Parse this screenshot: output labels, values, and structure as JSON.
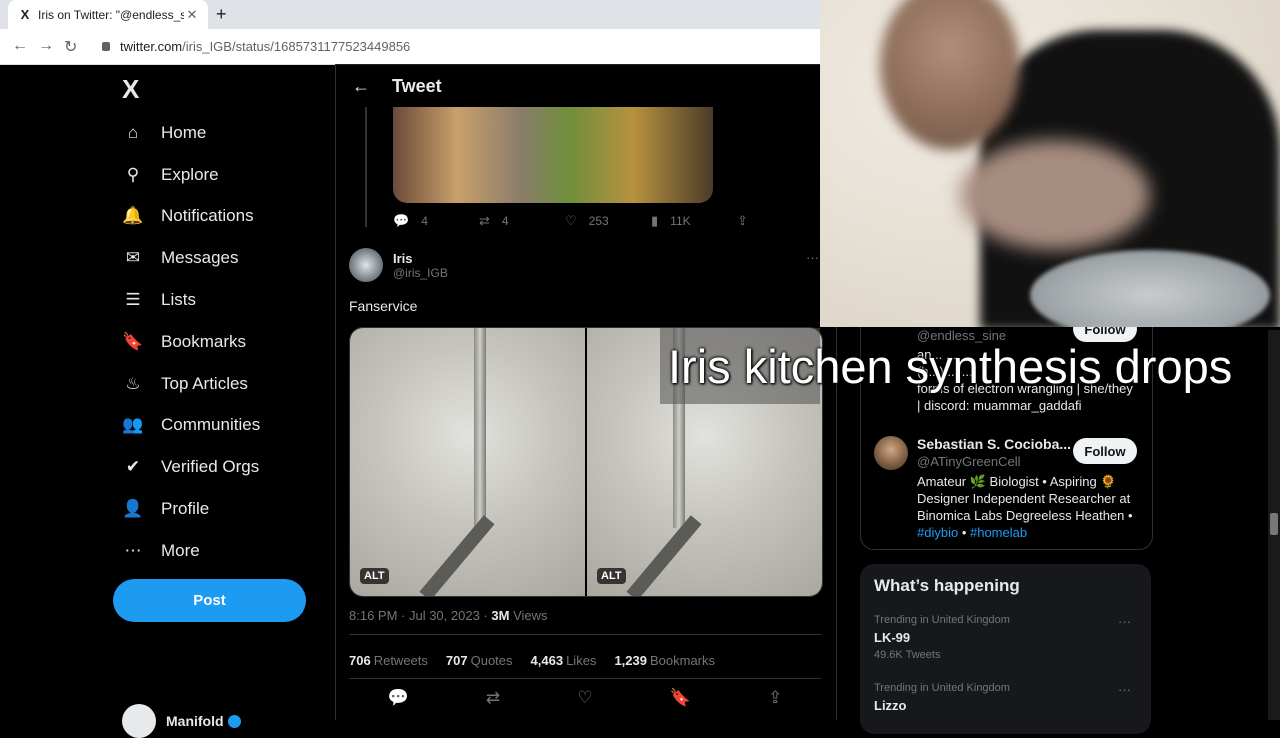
{
  "browser": {
    "tab_title": "Iris on Twitter: \"@endless_sine @",
    "tab_favicon": "X",
    "url_host": "twitter.com",
    "url_path": "/iris_IGB/status/1685731177523449856"
  },
  "sidebar": {
    "logo": "X",
    "items": [
      {
        "label": "Home",
        "icon": "home-icon",
        "glyph": "⌂"
      },
      {
        "label": "Explore",
        "icon": "search-icon",
        "glyph": "⚲"
      },
      {
        "label": "Notifications",
        "icon": "bell-icon",
        "glyph": "🔔"
      },
      {
        "label": "Messages",
        "icon": "envelope-icon",
        "glyph": "✉"
      },
      {
        "label": "Lists",
        "icon": "list-icon",
        "glyph": "☰"
      },
      {
        "label": "Bookmarks",
        "icon": "bookmark-icon",
        "glyph": "🔖"
      },
      {
        "label": "Top Articles",
        "icon": "flame-icon",
        "glyph": "♨"
      },
      {
        "label": "Communities",
        "icon": "people-icon",
        "glyph": "👥"
      },
      {
        "label": "Verified Orgs",
        "icon": "verified-icon",
        "glyph": "✔"
      },
      {
        "label": "Profile",
        "icon": "person-icon",
        "glyph": "👤"
      },
      {
        "label": "More",
        "icon": "more-circle-icon",
        "glyph": "⋯"
      }
    ],
    "post_label": "Post",
    "account_name": "Manifold"
  },
  "tweet": {
    "header_title": "Tweet",
    "prev_stats": {
      "replies": "4",
      "retweets": "4",
      "likes": "253",
      "views": "11K"
    },
    "author_name": "Iris",
    "author_handle": "@iris_IGB",
    "text": "Fanservice",
    "alt_label": "ALT",
    "time": "8:16 PM · Jul 30, 2023 ·",
    "views_count": "3M",
    "views_label": "Views",
    "counts": [
      {
        "value": "706",
        "label": "Retweets"
      },
      {
        "value": "707",
        "label": "Quotes"
      },
      {
        "value": "4,463",
        "label": "Likes"
      },
      {
        "value": "1,239",
        "label": "Bookmarks"
      }
    ]
  },
  "right": {
    "user1": {
      "handle": "@endless_sine",
      "follow": "Follow",
      "bio_lines": [
        "an... ...",
        "(h...) ... ...",
        "forms of electron wrangling | she/they",
        "| discord: muammar_gaddafi"
      ]
    },
    "user2": {
      "name": "Sebastian S. Cocioba...",
      "handle": "@ATinyGreenCell",
      "follow": "Follow",
      "bio": "Amateur 🌿 Biologist • Aspiring 🌻 Designer Independent Researcher at Binomica Labs Degreeless Heathen •",
      "tag1": "#diybio",
      "tag_sep": " • ",
      "tag2": "#homelab"
    },
    "trends": {
      "title": "What’s happening",
      "items": [
        {
          "context": "Trending in United Kingdom",
          "name": "LK-99",
          "count": "49.6K Tweets"
        },
        {
          "context": "Trending in United Kingdom",
          "name": "Lizzo",
          "count": ""
        }
      ]
    }
  },
  "overlay": {
    "caption": "Iris kitchen synthesis drops"
  }
}
